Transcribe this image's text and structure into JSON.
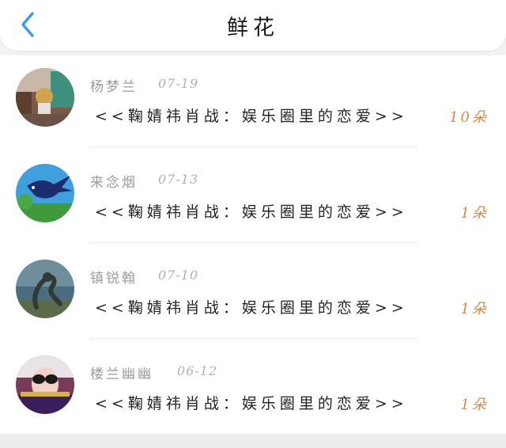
{
  "header": {
    "title": "鲜花",
    "back_icon": "chevron-left-icon",
    "accent_color": "#3d9be9"
  },
  "gifts": [
    {
      "name": "杨梦兰",
      "date": "07-19",
      "message": "<<鞠婧祎肖战：娱乐圈里的恋爱>>",
      "count": "10朵",
      "avatar": "avatar-photo-street"
    },
    {
      "name": "来念烟",
      "date": "07-13",
      "message": "<<鞠婧祎肖战：娱乐圈里的恋爱>>",
      "count": "1朵",
      "avatar": "avatar-swallow-bird"
    },
    {
      "name": "镇锐翰",
      "date": "07-10",
      "message": "<<鞠婧祎肖战：娱乐圈里的恋爱>>",
      "count": "1朵",
      "avatar": "avatar-sculpture"
    },
    {
      "name": "楼兰幽幽",
      "date": "06-12",
      "message": "<<鞠婧祎肖战：娱乐圈里的恋爱>>",
      "count": "1朵",
      "avatar": "avatar-girl-sunglasses"
    }
  ],
  "colors": {
    "count": "#d58a4a",
    "name": "#9b9b9b",
    "message": "#222222"
  }
}
